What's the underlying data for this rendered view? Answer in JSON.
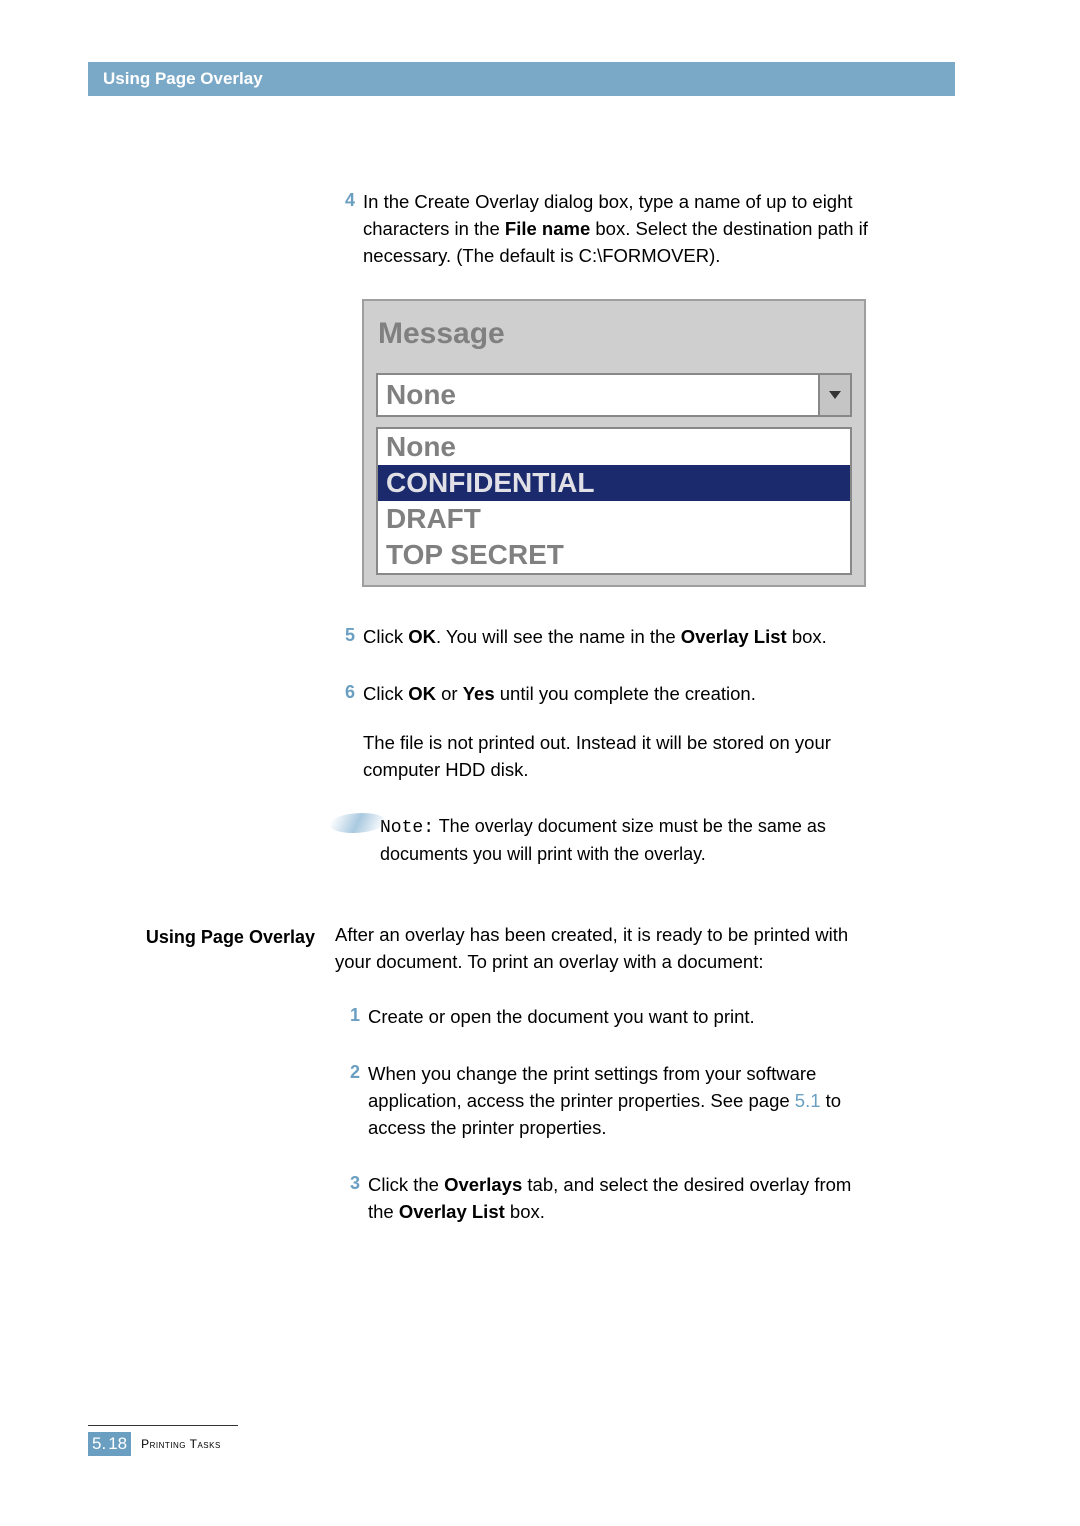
{
  "header": {
    "title": "Using Page Overlay"
  },
  "steps_a": [
    {
      "num": "4",
      "pre": "In the Create Overlay dialog box, type a name of up to eight characters in the ",
      "b1": "File name",
      "post": " box. Select the destination path if necessary. (The default is C:\\FORMOVER)."
    }
  ],
  "screenshot": {
    "group_label": "Message",
    "selected": "None",
    "options": [
      "None",
      "CONFIDENTIAL",
      "DRAFT",
      "TOP SECRET"
    ],
    "highlight_index": 1
  },
  "step5": {
    "num": "5",
    "t1": "Click ",
    "b1": "OK",
    "t2": ". You will see the name in the ",
    "b2": "Overlay List",
    "t3": " box."
  },
  "step6": {
    "num": "6",
    "t1": "Click ",
    "b1": "OK",
    "t2": " or ",
    "b2": "Yes",
    "t3": " until you complete the creation.",
    "para": "The file is not printed out. Instead it will be stored on your computer HDD disk."
  },
  "note": {
    "label": "Note:",
    "text_l1": " The overlay document size must be the same as",
    "text_l2": "documents you will print with the overlay."
  },
  "section_b": {
    "title": "Using Page Overlay",
    "intro": "After an overlay has been created, it is ready to be printed with your document. To print an overlay with a document:"
  },
  "steps_b": {
    "s1": {
      "num": "1",
      "text": "Create or open the document you want to print."
    },
    "s2": {
      "num": "2",
      "t1": "When you change the print settings from your software application, access the printer properties. See page ",
      "ref": "5.1",
      "t2": " to access the printer properties."
    },
    "s3": {
      "num": "3",
      "t1": "Click the ",
      "b1": "Overlays",
      "t2": " tab, and select the desired overlay from the ",
      "b2": "Overlay List",
      "t3": " box."
    }
  },
  "footer": {
    "chapter": "5.",
    "page": "18",
    "label": "Printing Tasks"
  }
}
